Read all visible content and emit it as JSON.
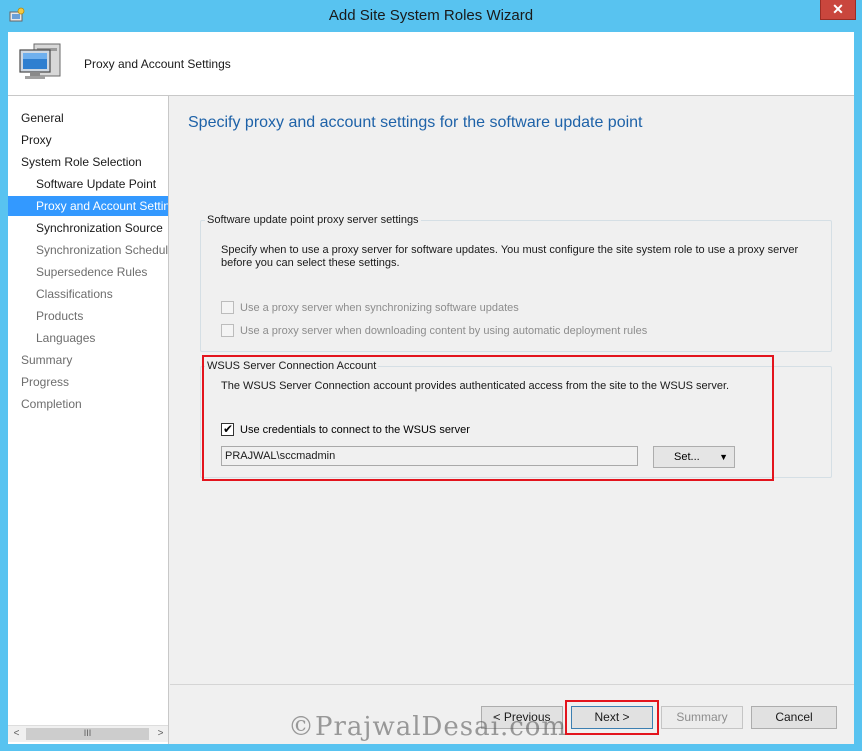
{
  "window": {
    "title": "Add Site System Roles Wizard",
    "close_glyph": "✕",
    "app_icon": "wizard-icon"
  },
  "header": {
    "title": "Proxy and Account Settings",
    "icon": "computer-monitor-icon"
  },
  "nav": {
    "items": [
      {
        "label": "General",
        "state": "normal"
      },
      {
        "label": "Proxy",
        "state": "normal"
      },
      {
        "label": "System Role Selection",
        "state": "normal"
      },
      {
        "label": "Software Update Point",
        "state": "normal"
      },
      {
        "label": "Proxy and Account Settings",
        "state": "selected"
      },
      {
        "label": "Synchronization Source",
        "state": "normal"
      },
      {
        "label": "Synchronization Schedule",
        "state": "disabled"
      },
      {
        "label": "Supersedence Rules",
        "state": "disabled"
      },
      {
        "label": "Classifications",
        "state": "disabled"
      },
      {
        "label": "Products",
        "state": "disabled"
      },
      {
        "label": "Languages",
        "state": "disabled"
      },
      {
        "label": "Summary",
        "state": "disabled"
      },
      {
        "label": "Progress",
        "state": "disabled"
      },
      {
        "label": "Completion",
        "state": "disabled"
      }
    ],
    "scroll_left": "<",
    "scroll_right": ">",
    "scroll_thumb": "III"
  },
  "main": {
    "heading": "Specify proxy and account settings for the software update point",
    "proxy_group": {
      "label": "Software update point proxy server settings",
      "description": "Specify when to use a proxy server for software updates. You must configure the site system role to use a proxy server before you can select these settings.",
      "checkbox_sync": {
        "label": "Use a proxy server when synchronizing software updates",
        "checked": false,
        "enabled": false
      },
      "checkbox_download": {
        "label": "Use a proxy server when downloading content by using automatic deployment rules",
        "checked": false,
        "enabled": false
      }
    },
    "wsus_group": {
      "label": "WSUS Server Connection Account",
      "description": "The WSUS Server Connection account provides authenticated access from the site to the WSUS server.",
      "checkbox_credentials": {
        "label": "Use credentials to connect to the WSUS server",
        "checked": true,
        "enabled": true
      },
      "account_value": "PRAJWAL\\sccmadmin",
      "set_button": "Set...",
      "set_dropdown_glyph": "▼"
    }
  },
  "footer": {
    "previous": "< Previous",
    "next": "Next >",
    "summary": "Summary",
    "cancel": "Cancel"
  },
  "watermark": "©PrajwalDesai.com",
  "colors": {
    "titlebar": "#58c3f0",
    "heading": "#1e62a8",
    "selection": "#3399ff",
    "annotation_red": "#e3141d"
  }
}
